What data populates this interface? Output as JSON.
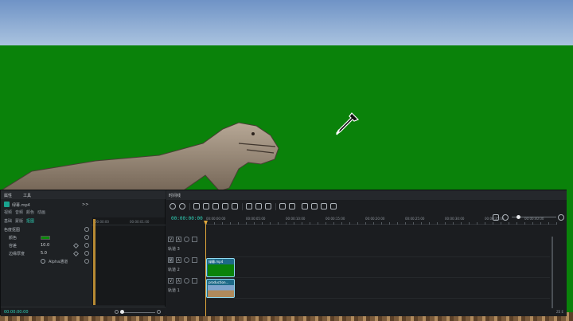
{
  "inspector": {
    "tabs": [
      "属性",
      "工具"
    ],
    "clip_name": "绿幕.mp4",
    "expand_glyph": ">>",
    "subtabs": [
      "视频",
      "音频",
      "颜色",
      "动画"
    ],
    "subtabs2": [
      "基础",
      "蒙版",
      "抠图"
    ],
    "props": {
      "section": "色度抠图",
      "color_label": "颜色",
      "tolerance_label": "容差",
      "tolerance_value": "10.0",
      "edge_label": "边缘厚度",
      "edge_value": "5.0",
      "alpha_label": "Alpha通道",
      "key_color": "#0b8a0b"
    },
    "mini_ruler": [
      "00:00:00",
      "00:00:01:00"
    ],
    "bottom_timecode": "00:00:00:00"
  },
  "timeline": {
    "tab_label": "时间线",
    "timecode": "00:00:00:00",
    "ruler_labels": [
      "00:00:00:00",
      "00:00:05:00",
      "00:00:10:00",
      "00:00:15:00",
      "00:00:20:00",
      "00:00:25:00",
      "00:00:30:00",
      "00:00:35:00",
      "00:00:40:00",
      "00:00:45:00",
      "00:00:50:00",
      "00:00:55:00"
    ],
    "tracks": [
      {
        "name": "轨道 3",
        "btn_v": "V",
        "btn_a": "A"
      },
      {
        "name": "轨道 2",
        "btn_v": "V",
        "btn_a": "A"
      },
      {
        "name": "轨道 1",
        "btn_v": "V",
        "btn_a": "A"
      }
    ],
    "clips": {
      "green_clip": "绿幕.mp4",
      "bg_clip": "production..."
    },
    "corner_label": "ZE E"
  },
  "colors": {
    "accent": "#2fd3b8",
    "playhead": "#e0a63a",
    "clip_border": "#8fdaf2"
  }
}
